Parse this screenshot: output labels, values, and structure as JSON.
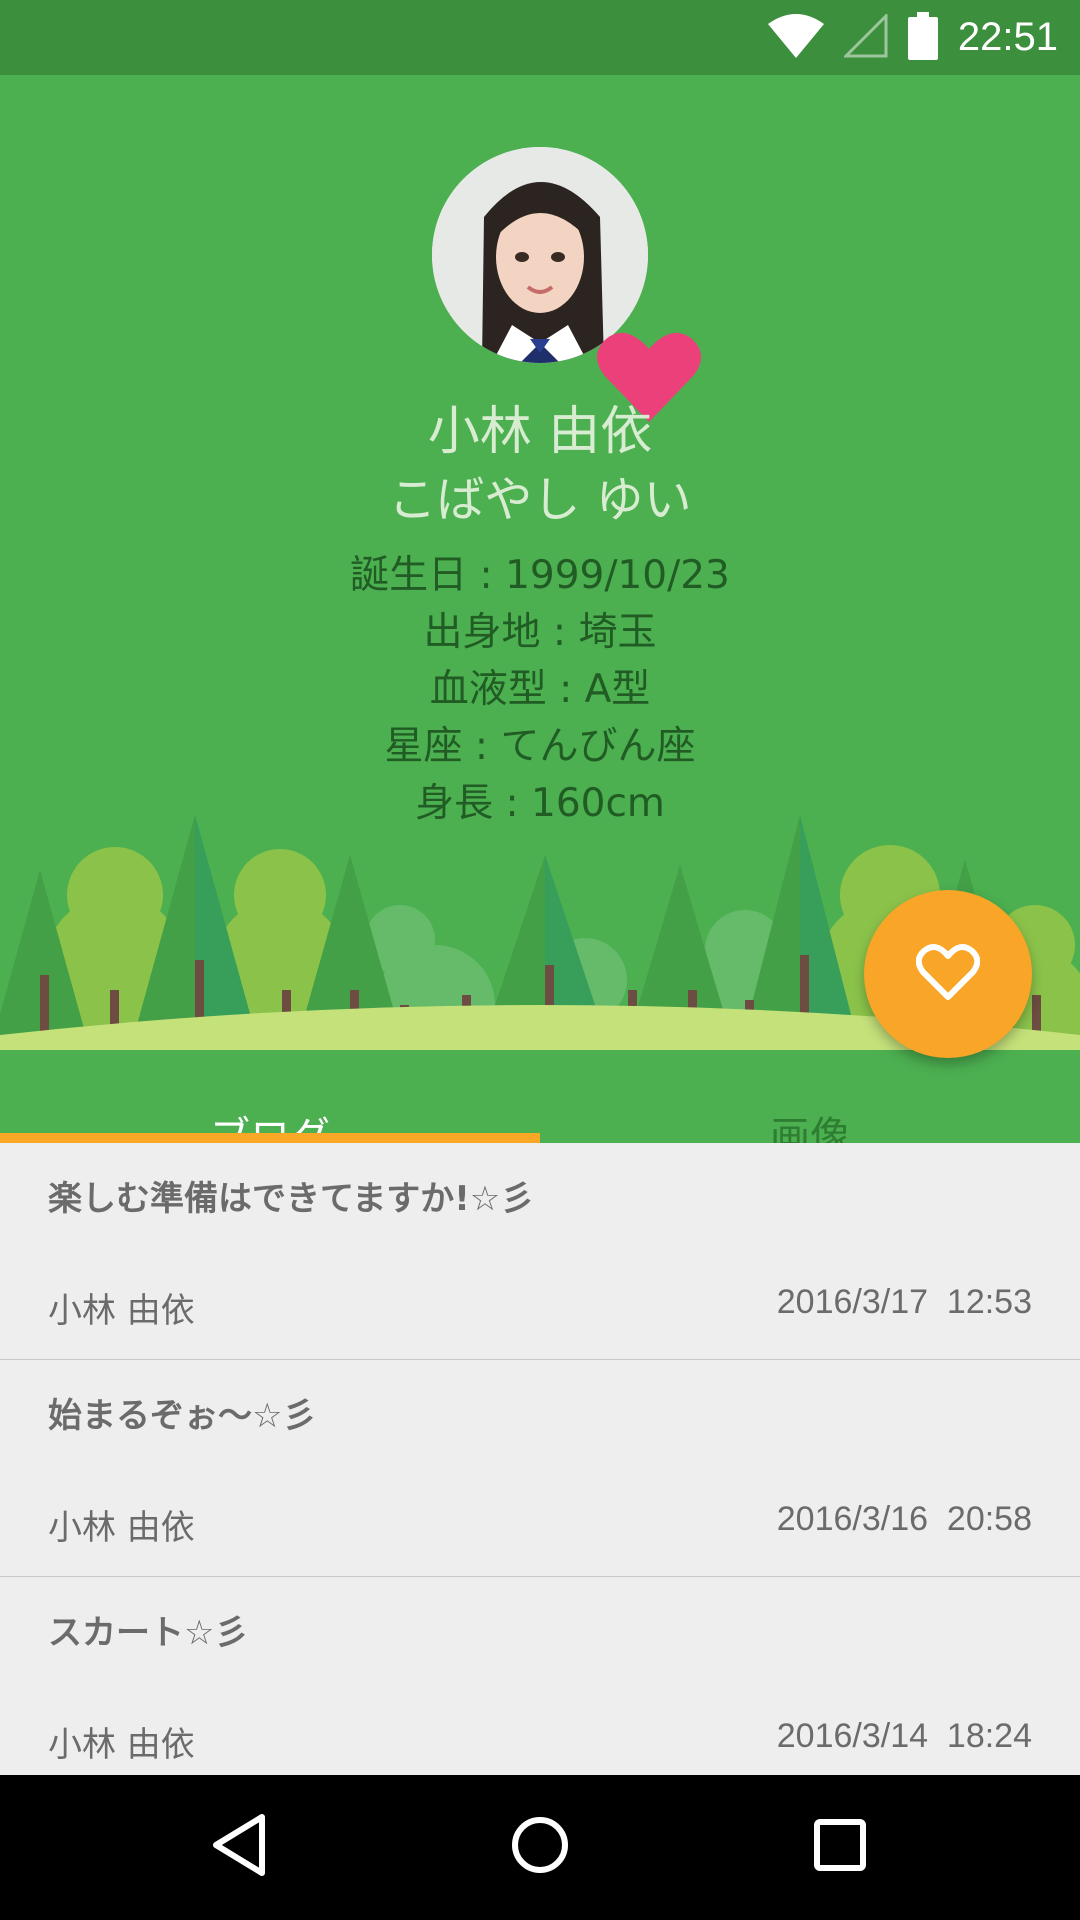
{
  "status_bar": {
    "time": "22:51",
    "icons": [
      "wifi-icon",
      "cell-signal-icon",
      "battery-icon"
    ]
  },
  "profile": {
    "name": "小林 由依",
    "reading": "こばやし ゆい",
    "details": [
      "誕生日 : 1999/10/23",
      "出身地 : 埼玉",
      "血液型 : A型",
      "星座 : てんびん座",
      "身長 : 160cm"
    ]
  },
  "tabs": [
    {
      "label": "ブログ",
      "selected": true
    },
    {
      "label": "画像",
      "selected": false
    }
  ],
  "posts": [
    {
      "title": "楽しむ準備はできてますか!☆彡",
      "author": "小林 由依",
      "date": "2016/3/17  12:53"
    },
    {
      "title": "始まるぞぉ～☆彡",
      "author": "小林 由依",
      "date": "2016/3/16  20:58"
    },
    {
      "title": "スカート☆彡",
      "author": "小林 由依",
      "date": "2016/3/14  18:24"
    }
  ],
  "colors": {
    "header": "#4caf50",
    "status_bar": "#3c8f3d",
    "accent": "#f9a628",
    "heart": "#ec407a"
  },
  "nav": [
    "back-icon",
    "home-icon",
    "recents-icon"
  ]
}
